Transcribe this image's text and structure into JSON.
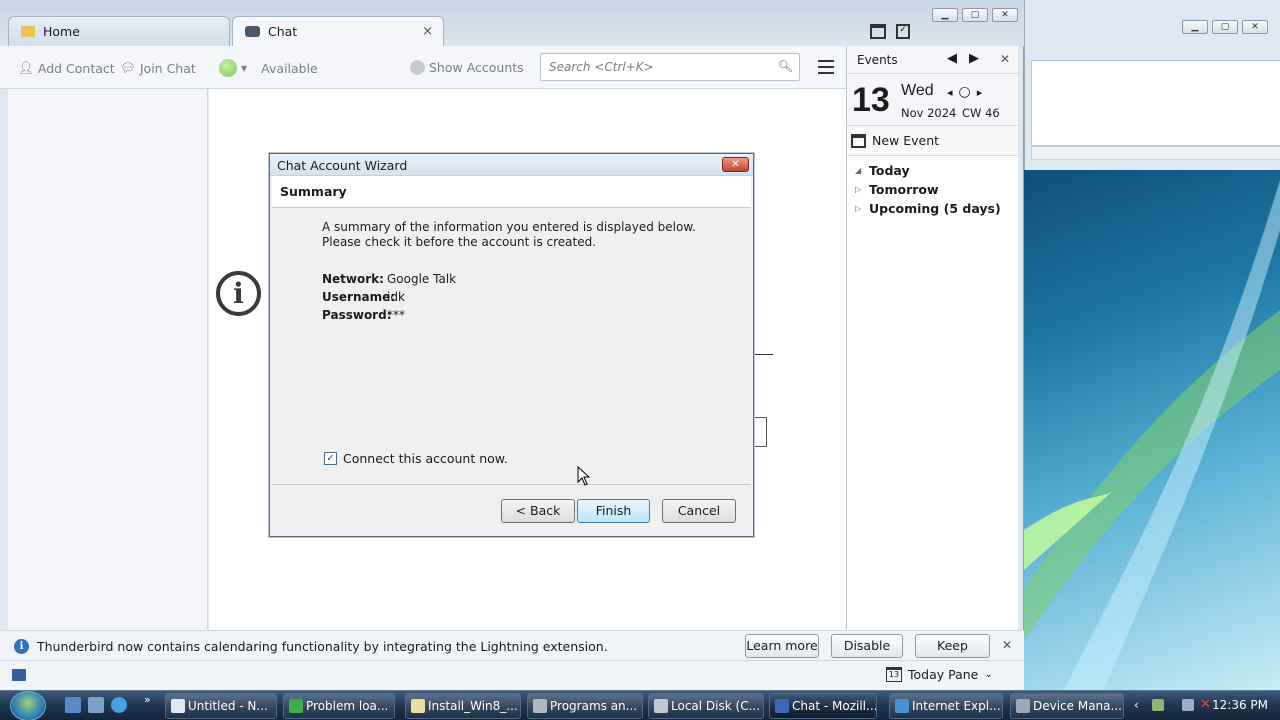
{
  "tabs": [
    {
      "label": "Home"
    },
    {
      "label": "Chat",
      "close": "×"
    }
  ],
  "toolbar": {
    "add_contact": "Add Contact",
    "join_chat": "Join Chat",
    "status": "Available",
    "show_accounts": "Show Accounts",
    "search_placeholder": "Search <Ctrl+K>"
  },
  "today_pane": {
    "header": "Events",
    "day": "13",
    "weekday": "Wed",
    "month_year": "Nov 2024",
    "calendar_week": "CW 46",
    "new_event": "New Event",
    "sections": [
      "Today",
      "Tomorrow",
      "Upcoming (5 days)"
    ]
  },
  "dialog": {
    "title": "Chat Account Wizard",
    "heading": "Summary",
    "description": "A summary of the information you entered is displayed below. Please check it before the account is created.",
    "fields": [
      {
        "key": "Network:",
        "value": "Google Talk"
      },
      {
        "key": "Username:",
        "value": "idk"
      },
      {
        "key": "Password:",
        "value": "***"
      }
    ],
    "connect_label": "Connect this account now.",
    "connect_checked": true,
    "back": "< Back",
    "finish": "Finish",
    "cancel": "Cancel"
  },
  "notification": {
    "message": "Thunderbird now contains calendaring functionality by integrating the Lightning extension.",
    "learn_more": "Learn more",
    "disable": "Disable",
    "keep": "Keep"
  },
  "statusbar": {
    "today_pane": "Today Pane",
    "today_pane_day": "13"
  },
  "taskbar": {
    "buttons": [
      {
        "label": "Untitled - N...",
        "color": "#dfe8f0"
      },
      {
        "label": "Problem loa...",
        "color": "#3fae4a"
      },
      {
        "label": "Install_Win8_...",
        "color": "#e8e0a0"
      },
      {
        "label": "Programs an...",
        "color": "#b0b8c0"
      },
      {
        "label": "Local Disk (C...",
        "color": "#c0c8d0"
      },
      {
        "label": "Chat - Mozill...",
        "color": "#3a6ab8"
      },
      {
        "label": "Internet Expl...",
        "color": "#4a90d8"
      },
      {
        "label": "Device Mana...",
        "color": "#9aa8b8"
      }
    ],
    "clock": "12:36 PM"
  },
  "colors": {
    "accent": "#3c7fb1",
    "desktop": "#3a8ab8"
  }
}
